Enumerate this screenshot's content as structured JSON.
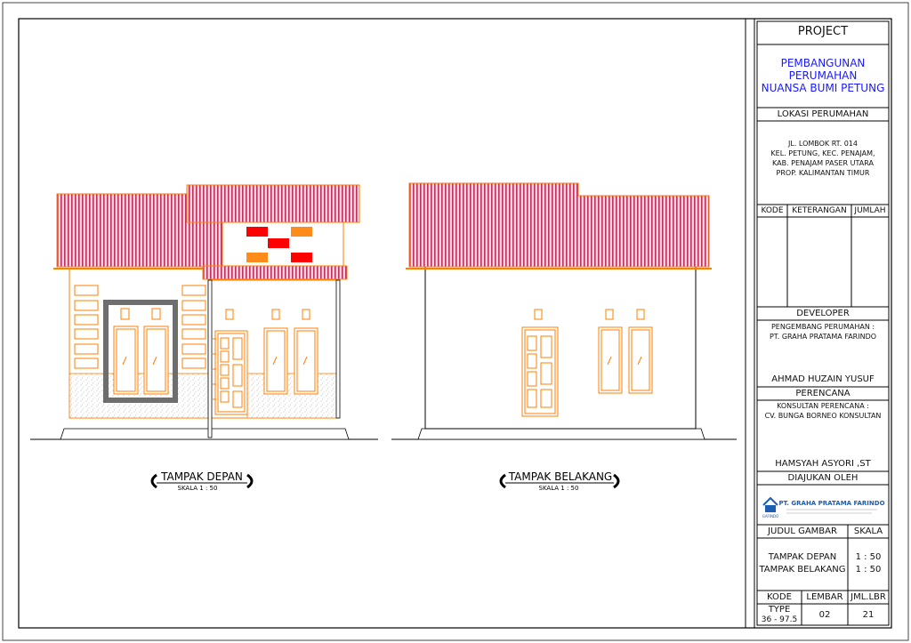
{
  "title_block": {
    "project_label": "PROJECT",
    "project_name": [
      "PEMBANGUNAN",
      "PERUMAHAN",
      "NUANSA BUMI PETUNG"
    ],
    "location_label": "LOKASI PERUMAHAN",
    "location_lines": [
      "JL. LOMBOK RT. 014",
      "KEL. PETUNG, KEC. PENAJAM,",
      "KAB. PENAJAM PASER UTARA",
      "PROP. KALIMANTAN TIMUR"
    ],
    "table_headers": [
      "KODE",
      "KETERANGAN",
      "JUMLAH"
    ],
    "developer_label": "DEVELOPER",
    "developer_lines": [
      "PENGEMBANG PERUMAHAN :",
      "PT. GRAHA PRATAMA FARINDO"
    ],
    "developer_person": "AHMAD HUZAIN YUSUF",
    "planner_label": "PERENCANA",
    "planner_lines": [
      "KONSULTAN PERENCANA :",
      "CV. BUNGA BORNEO KONSULTAN"
    ],
    "planner_person": "HAMSYAH ASYORI ,ST",
    "submitted_label": "DIAJUKAN OLEH",
    "logo_company": "PT. GRAHA PRATAMA FARINDO",
    "logo_mark": "GAFINDO",
    "drawing_title_label": "JUDUL GAMBAR",
    "scale_label": "SKALA",
    "drawing_titles": [
      "TAMPAK DEPAN",
      "TAMPAK BELAKANG"
    ],
    "drawing_scales": [
      "1 : 50",
      "1 : 50"
    ],
    "footer_headers": [
      "KODE",
      "LEMBAR",
      "JML.LBR"
    ],
    "footer_type": [
      "TYPE",
      "36 - 97.5"
    ],
    "sheet": "02",
    "total_sheets": "21"
  },
  "views": [
    {
      "title": "TAMPAK DEPAN",
      "scale": "SKALA 1 : 50"
    },
    {
      "title": "TAMPAK BELAKANG",
      "scale": "SKALA 1 : 50"
    }
  ],
  "colors": {
    "outline": "#ff7f00",
    "roof_stripe": "#c0305a",
    "roof_fill": "#f4c9d8",
    "accent_red": "#ff0000",
    "accent_orange": "#ff8c1a",
    "frame_grey": "#6e6e6e",
    "title_blue": "#1a1aff"
  }
}
